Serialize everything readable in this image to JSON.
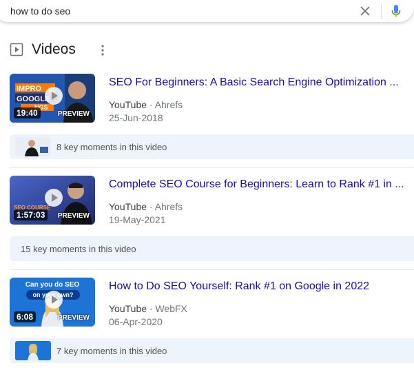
{
  "search": {
    "query": "how to do seo"
  },
  "section": {
    "title": "Videos"
  },
  "results": [
    {
      "title": "SEO For Beginners: A Basic Search Engine Optimization ...",
      "source": "YouTube",
      "channel": "Ahrefs",
      "date": "25-Jun-2018",
      "duration": "19:40",
      "preview_label": "PREVIEW",
      "thumb_text": [
        "IMPRO",
        "GOOGLE",
        "NGS"
      ],
      "thumb_colors": {
        "bg": "#1b3d7a",
        "accent": "#ff7a00"
      },
      "moments": "8 key moments in this video"
    },
    {
      "title": "Complete SEO Course for Beginners: Learn to Rank #1 in ...",
      "source": "YouTube",
      "channel": "Ahrefs",
      "date": "19-May-2021",
      "duration": "1:57:03",
      "preview_label": "PREVIEW",
      "thumb_text": [
        "SEO COURSE"
      ],
      "thumb_colors": {
        "bg": "#2a3d8f",
        "accent": "#ff7a00"
      },
      "moments": "15 key moments in this video"
    },
    {
      "title": "How to Do SEO Yourself: Rank #1 on Google in 2022",
      "source": "YouTube",
      "channel": "WebFX",
      "date": "06-Apr-2020",
      "duration": "6:08",
      "preview_label": "PREVIEW",
      "thumb_text": [
        "Can you do SEO",
        "on your own?"
      ],
      "thumb_colors": {
        "bg": "#1e73d6",
        "accent": "#0b3d91"
      },
      "moments": "7 key moments in this video"
    }
  ],
  "colors": {
    "link": "#1a0dab",
    "moments_bg": "#eef4fb",
    "mic_blue": "#4285f4"
  }
}
